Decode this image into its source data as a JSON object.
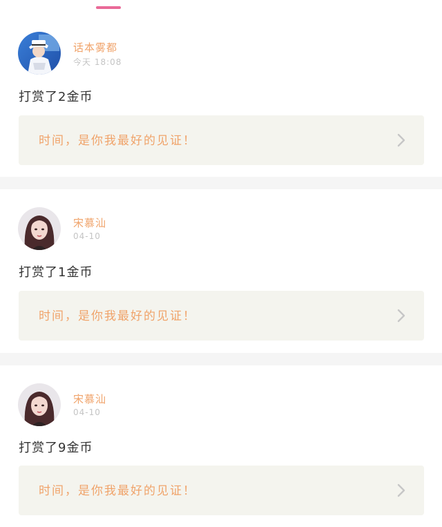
{
  "feed": {
    "posts": [
      {
        "username": "话本雾都",
        "time": "今天 18:08",
        "action": "打赏了2金币",
        "quote": "时间，是你我最好的见证！",
        "avatar_icon": "avatar-boy-white-hat"
      },
      {
        "username": "宋慕汕",
        "time": "04-10",
        "action": "打赏了1金币",
        "quote": "时间，是你我最好的见证！",
        "avatar_icon": "avatar-girl-dark-hair"
      },
      {
        "username": "宋慕汕",
        "time": "04-10",
        "action": "打赏了9金币",
        "quote": "时间，是你我最好的见证！",
        "avatar_icon": "avatar-girl-dark-hair"
      }
    ]
  },
  "colors": {
    "accent_pink": "#e96a98",
    "name_orange": "#f0a36a",
    "quote_bg": "#f4f4ee",
    "divider_gray": "#f5f5f5"
  }
}
